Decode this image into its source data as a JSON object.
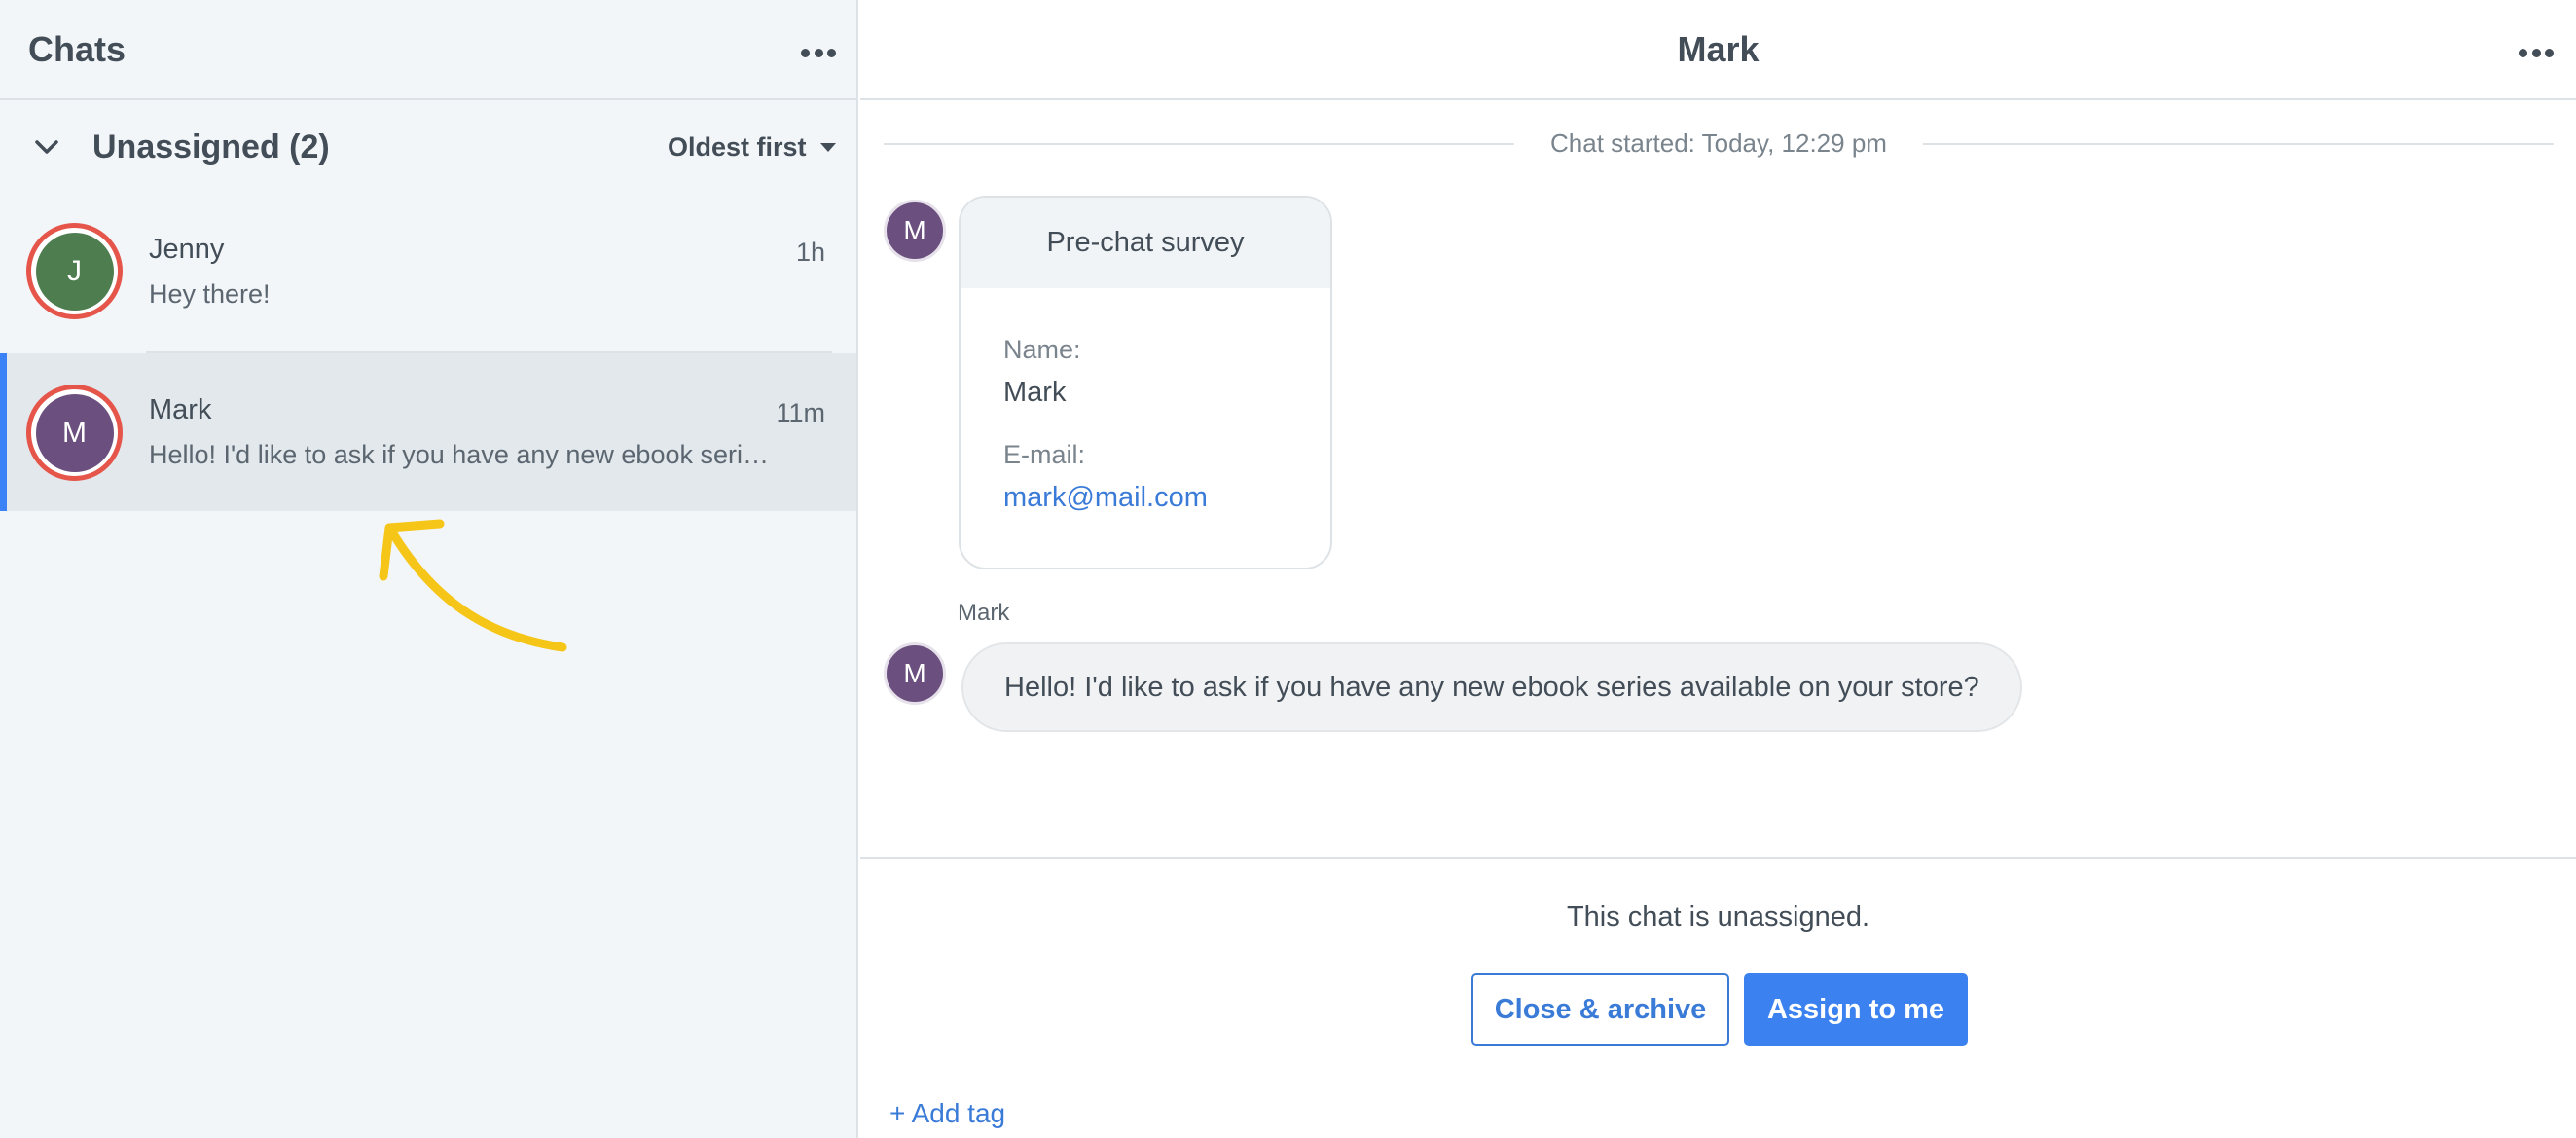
{
  "sidebar": {
    "title": "Chats",
    "menu_icon": "more-dots-icon",
    "group": {
      "title": "Unassigned (2)",
      "sort_label": "Oldest first"
    },
    "chats": [
      {
        "name": "Jenny",
        "initial": "J",
        "time": "1h",
        "preview": "Hey there!",
        "avatar_color": "#4e7d4f",
        "selected": false
      },
      {
        "name": "Mark",
        "initial": "M",
        "time": "11m",
        "preview": "Hello! I'd like to ask if you have any new ebook series available on your store?",
        "avatar_color": "#6b4f7e",
        "selected": true
      }
    ]
  },
  "conversation": {
    "title": "Mark",
    "chat_started": "Chat started: Today, 12:29 pm",
    "avatar_initial": "M",
    "survey": {
      "title": "Pre-chat survey",
      "name_label": "Name:",
      "name_value": "Mark",
      "email_label": "E-mail:",
      "email_value": "mark@mail.com"
    },
    "message": {
      "sender": "Mark",
      "text": "Hello! I'd like to ask if you have any new ebook series available on your store?"
    },
    "status": "This chat is unassigned.",
    "close_button": "Close & archive",
    "assign_button": "Assign to me",
    "add_tag": "+ Add tag"
  },
  "colors": {
    "accent": "#3b82f0",
    "unread_ring": "#e5554a",
    "annotation_arrow": "#f5c518"
  }
}
